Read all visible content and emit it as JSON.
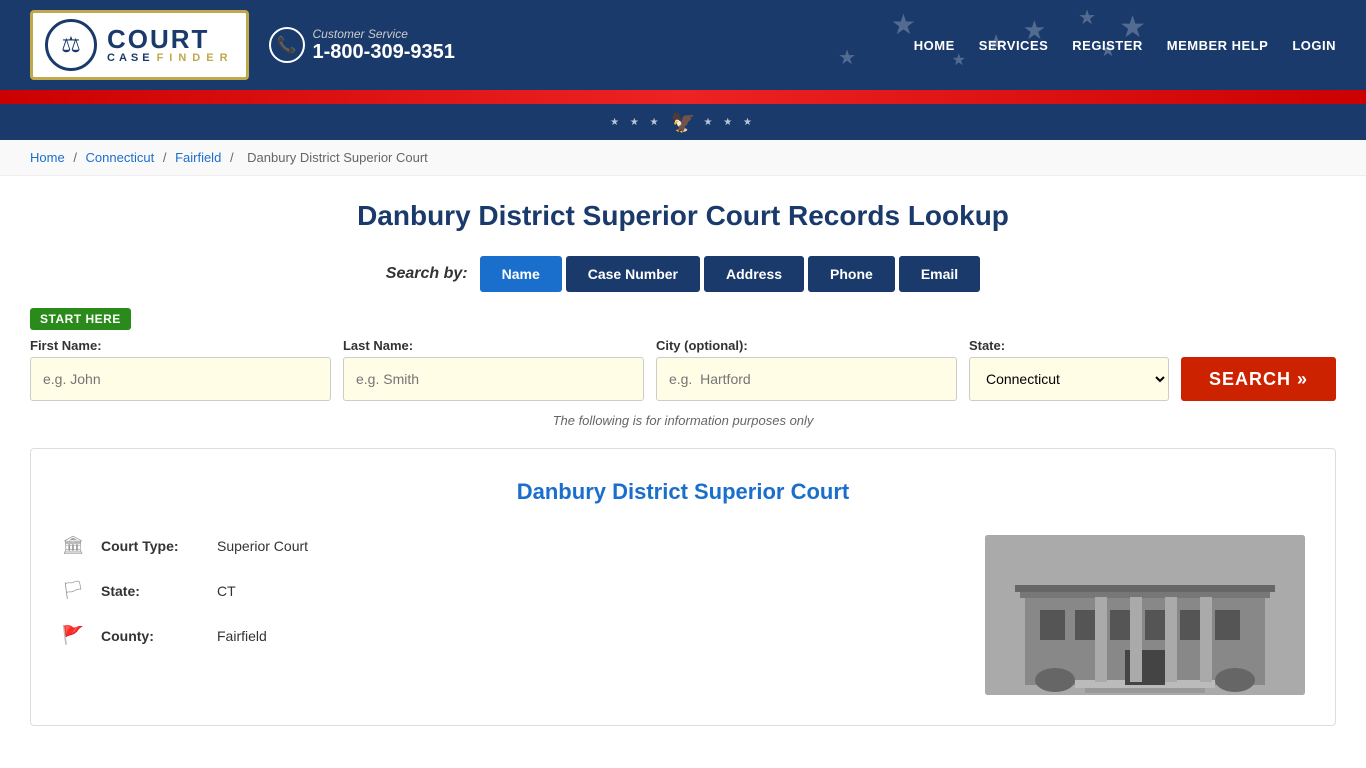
{
  "header": {
    "logo": {
      "court": "COURT",
      "case": "CASE",
      "finder": "FINDER"
    },
    "customer_service_label": "Customer Service",
    "phone": "1-800-309-9351",
    "nav": [
      {
        "label": "HOME",
        "href": "#"
      },
      {
        "label": "SERVICES",
        "href": "#"
      },
      {
        "label": "REGISTER",
        "href": "#"
      },
      {
        "label": "MEMBER HELP",
        "href": "#"
      },
      {
        "label": "LOGIN",
        "href": "#"
      }
    ]
  },
  "breadcrumb": {
    "items": [
      {
        "label": "Home",
        "href": "#"
      },
      {
        "label": "Connecticut",
        "href": "#"
      },
      {
        "label": "Fairfield",
        "href": "#"
      },
      {
        "label": "Danbury District Superior Court",
        "href": null
      }
    ]
  },
  "page": {
    "title": "Danbury District Superior Court Records Lookup"
  },
  "search": {
    "by_label": "Search by:",
    "tabs": [
      {
        "label": "Name",
        "active": true
      },
      {
        "label": "Case Number",
        "active": false
      },
      {
        "label": "Address",
        "active": false
      },
      {
        "label": "Phone",
        "active": false
      },
      {
        "label": "Email",
        "active": false
      }
    ],
    "start_here_badge": "START HERE",
    "fields": [
      {
        "label": "First Name:",
        "placeholder": "e.g. John",
        "type": "text"
      },
      {
        "label": "Last Name:",
        "placeholder": "e.g. Smith",
        "type": "text"
      },
      {
        "label": "City (optional):",
        "placeholder": "e.g.  Hartford",
        "type": "text"
      },
      {
        "label": "State:",
        "type": "select",
        "value": "Connecticut"
      }
    ],
    "button_label": "SEARCH »",
    "disclaimer": "The following is for information purposes only"
  },
  "court_card": {
    "title": "Danbury District Superior Court",
    "details": [
      {
        "icon": "🏛",
        "label": "Court Type:",
        "value": "Superior Court"
      },
      {
        "icon": "🏳",
        "label": "State:",
        "value": "CT"
      },
      {
        "icon": "🚩",
        "label": "County:",
        "value": "Fairfield"
      }
    ]
  }
}
